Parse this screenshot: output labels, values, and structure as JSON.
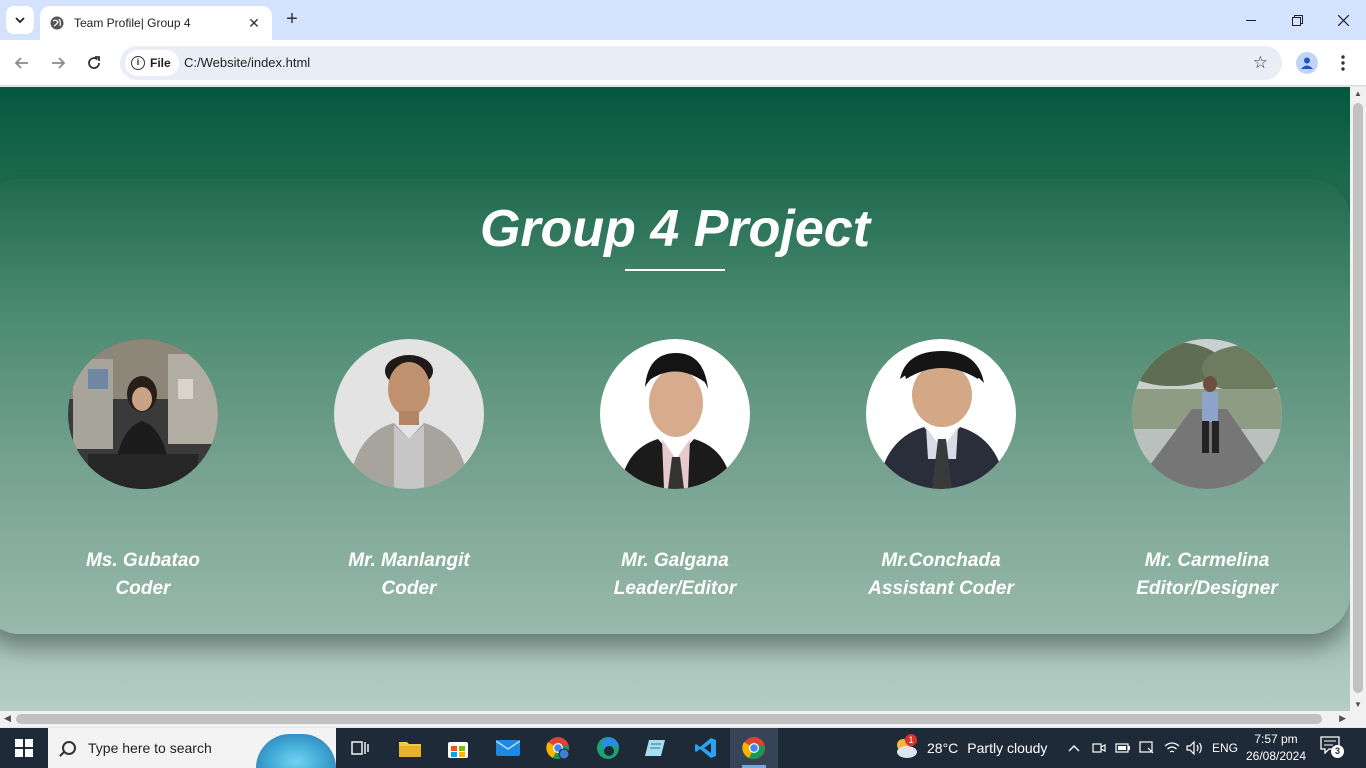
{
  "browser": {
    "tab_title": "Team Profile| Group 4",
    "chip_label": "File",
    "url": "C:/Website/index.html"
  },
  "page": {
    "heading": "Group 4 Project",
    "members": [
      {
        "name": "Ms. Gubatao",
        "role": "Coder"
      },
      {
        "name": "Mr. Manlangit",
        "role": "Coder"
      },
      {
        "name": "Mr. Galgana",
        "role": "Leader/Editor"
      },
      {
        "name": "Mr.Conchada",
        "role": "Assistant Coder"
      },
      {
        "name": "Mr. Carmelina",
        "role": "Editor/Designer"
      }
    ]
  },
  "taskbar": {
    "search_placeholder": "Type here to search",
    "weather_temp": "28°C",
    "weather_text": "Partly cloudy",
    "weather_badge": "1",
    "language": "ENG",
    "time": "7:57 pm",
    "date": "26/08/2024",
    "notification_count": "3"
  },
  "colors": {
    "tabbar": "#d3e3fd",
    "page_top": "#03583d",
    "page_bottom": "#b4cdc5",
    "taskbar": "#1f2a38"
  }
}
